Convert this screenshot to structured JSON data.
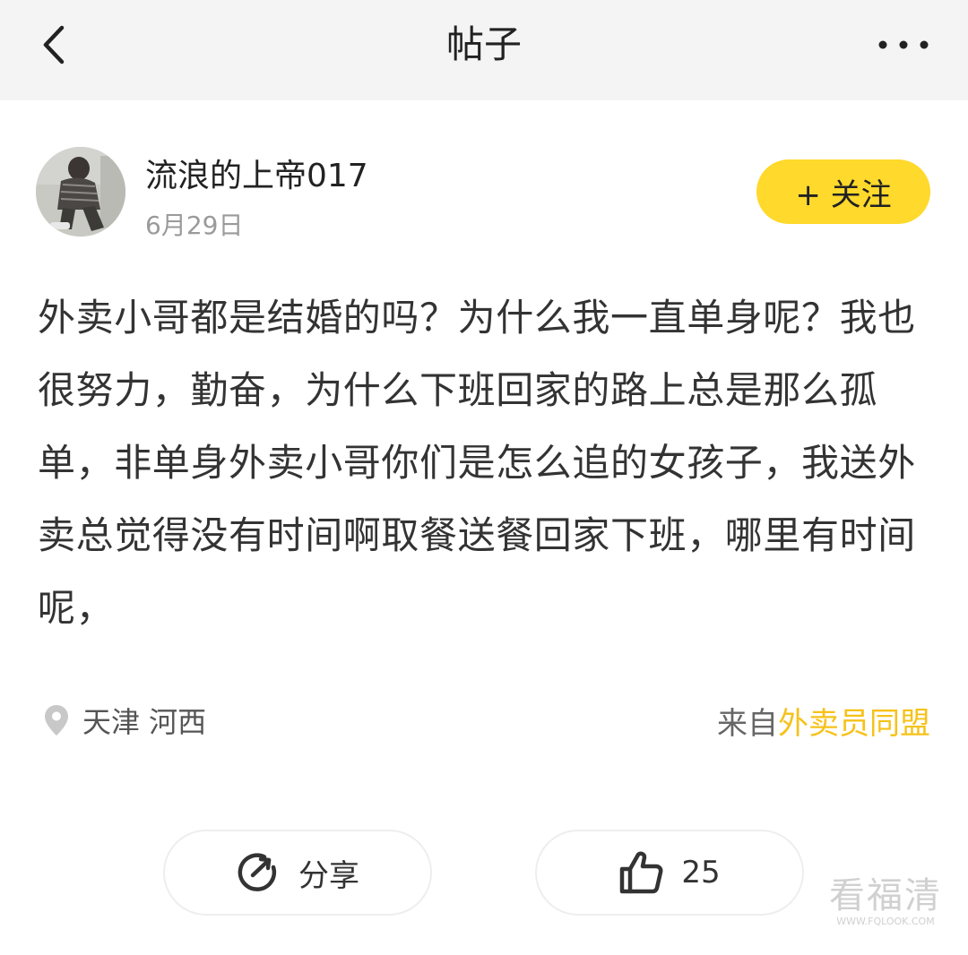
{
  "header": {
    "title": "帖子",
    "back_icon": "chevron-left-icon",
    "more_icon": "more-horizontal-icon"
  },
  "author": {
    "name": "流浪的上帝017",
    "date": "6月29日",
    "follow_label": "+ 关注"
  },
  "post": {
    "content": "外卖小哥都是结婚的吗？为什么我一直单身呢？我也很努力，勤奋，为什么下班回家的路上总是那么孤单，非单身外卖小哥你们是怎么追的女孩子，我送外卖总觉得没有时间啊取餐送餐回家下班，哪里有时间呢，"
  },
  "meta": {
    "location": "天津 河西",
    "source_prefix": "来自",
    "source_name": "外卖员同盟"
  },
  "actions": {
    "share_label": "分享",
    "like_count": "25"
  },
  "watermark": {
    "main": "看福清",
    "sub": "WWW.FQLOOK.COM"
  },
  "colors": {
    "accent": "#ffd92b",
    "source_link": "#f6c21a",
    "header_bg": "#f4f4f4"
  }
}
